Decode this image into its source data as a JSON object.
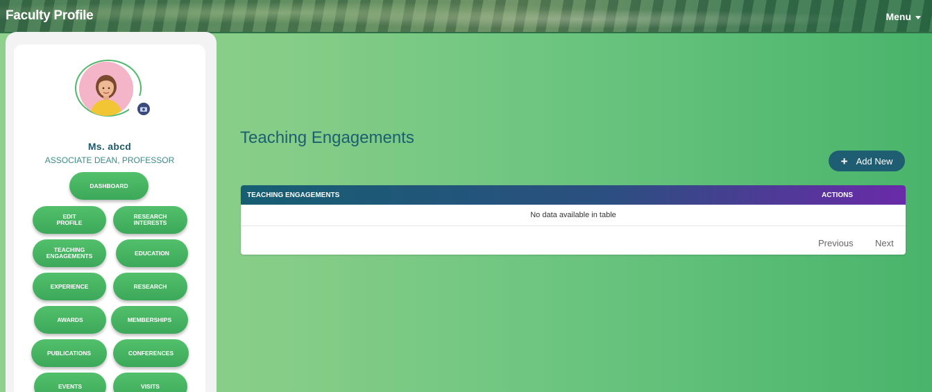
{
  "header": {
    "brand": "Faculty Profile",
    "menu_label": "Menu"
  },
  "profile": {
    "name": "Ms. abcd",
    "title": "ASSOCIATE DEAN, PROFESSOR",
    "avatar_icon": "avatar-icon",
    "camera_icon": "camera-icon"
  },
  "sidebar": {
    "buttons": [
      {
        "label": "DASHBOARD"
      },
      {
        "label": "EDIT\nPROFILE"
      },
      {
        "label": "RESEARCH\nINTERESTS"
      },
      {
        "label": "TEACHING\nENGAGEMENTS"
      },
      {
        "label": "EDUCATION"
      },
      {
        "label": "EXPERIENCE"
      },
      {
        "label": "RESEARCH"
      },
      {
        "label": "AWARDS"
      },
      {
        "label": "MEMBERSHIPS"
      },
      {
        "label": "PUBLICATIONS"
      },
      {
        "label": "CONFERENCES"
      },
      {
        "label": "EVENTS"
      },
      {
        "label": "VISITS"
      }
    ]
  },
  "main": {
    "title": "Teaching Engagements",
    "add_label": "Add New",
    "table": {
      "columns": [
        "TEACHING ENGAGEMENTS",
        "ACTIONS"
      ],
      "empty_text": "No data available in table",
      "prev_label": "Previous",
      "next_label": "Next"
    }
  },
  "colors": {
    "accent_green": "#4fb86a",
    "header_teal": "#1f5d72",
    "header_purple": "#6a2aa8"
  }
}
